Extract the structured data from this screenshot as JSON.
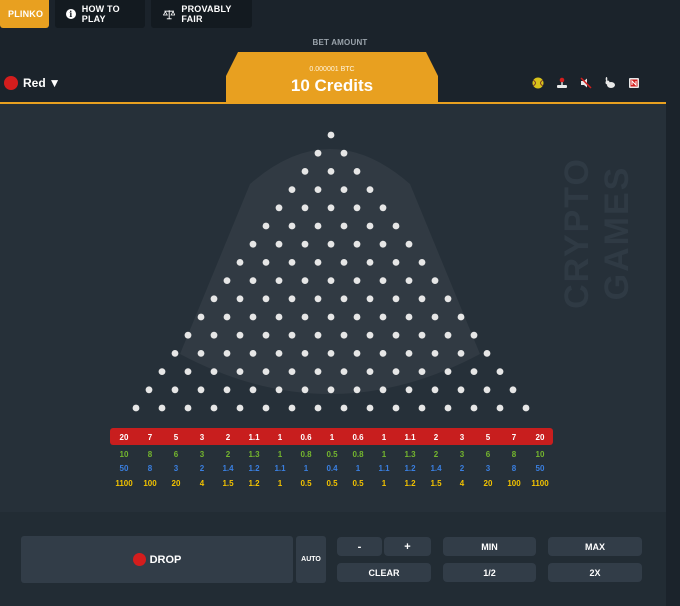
{
  "tabs": [
    {
      "label": "PLINKO",
      "active": true
    },
    {
      "label": "HOW TO PLAY",
      "active": false
    },
    {
      "label": "PROVABLY FAIR",
      "active": false
    }
  ],
  "bet": {
    "label": "BET AMOUNT",
    "btc": "0.000001 BTC",
    "credits": "10 Credits"
  },
  "color": {
    "label": "Red",
    "value": "#d41d1d"
  },
  "colors": {
    "accent": "#e8a020",
    "red_row": "#c81e1e",
    "green": "#74b62e",
    "blue": "#3a7fe0",
    "yellow": "#f2c200"
  },
  "brand": {
    "line1": "CRYPTO",
    "line2": "GAMES"
  },
  "icons": [
    "tennis-ball-icon",
    "joystick-icon",
    "mute-icon",
    "rabbit-icon",
    "news-icon"
  ],
  "board": {
    "rows": 16,
    "multipliers": {
      "red": [
        "20",
        "7",
        "5",
        "3",
        "2",
        "1.1",
        "1",
        "0.6",
        "1",
        "0.6",
        "1",
        "1.1",
        "2",
        "3",
        "5",
        "7",
        "20"
      ],
      "green": [
        "10",
        "8",
        "6",
        "3",
        "2",
        "1.3",
        "1",
        "0.8",
        "0.5",
        "0.8",
        "1",
        "1.3",
        "2",
        "3",
        "6",
        "8",
        "10"
      ],
      "blue": [
        "50",
        "8",
        "3",
        "2",
        "1.4",
        "1.2",
        "1.1",
        "1",
        "0.4",
        "1",
        "1.1",
        "1.2",
        "1.4",
        "2",
        "3",
        "8",
        "50"
      ],
      "yellow": [
        "1100",
        "100",
        "20",
        "4",
        "1.5",
        "1.2",
        "1",
        "0.5",
        "0.5",
        "0.5",
        "1",
        "1.2",
        "1.5",
        "4",
        "20",
        "100",
        "1100"
      ]
    }
  },
  "controls": {
    "drop": "DROP",
    "auto": "AUTO",
    "minus": "-",
    "plus": "+",
    "clear": "CLEAR",
    "min": "MIN",
    "half": "1/2",
    "max": "MAX",
    "double": "2X"
  }
}
